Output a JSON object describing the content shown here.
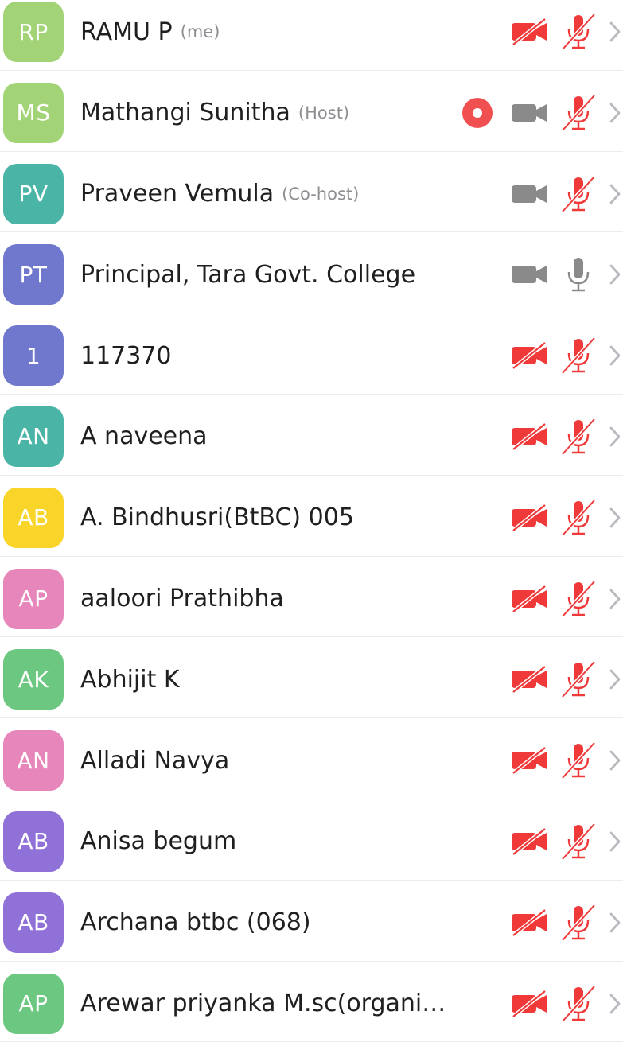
{
  "colors": {
    "muted_red": "#f03a3a",
    "active_gray": "#8a8a8a",
    "recording_red": "#f05050",
    "chevron": "#b9b9bf"
  },
  "icons": {
    "video": "video-camera-icon",
    "video_off": "video-off-icon",
    "mic": "microphone-icon",
    "mic_off": "microphone-muted-icon",
    "recording": "recording-icon",
    "chevron": "chevron-right-icon"
  },
  "participants": [
    {
      "initials": "RP",
      "name": "RAMU P",
      "tag": "(me)",
      "color": "#a2d477",
      "video": "off",
      "audio": "muted",
      "recording": false
    },
    {
      "initials": "MS",
      "name": "Mathangi Sunitha",
      "tag": "(Host)",
      "color": "#a2d477",
      "video": "on",
      "audio": "muted",
      "recording": true
    },
    {
      "initials": "PV",
      "name": "Praveen Vemula",
      "tag": "(Co-host)",
      "color": "#4ab5a6",
      "video": "on",
      "audio": "muted",
      "recording": false
    },
    {
      "initials": "PT",
      "name": "Principal, Tara Govt. College",
      "tag": "",
      "color": "#6f78cc",
      "video": "on",
      "audio": "on",
      "recording": false
    },
    {
      "initials": "1",
      "name": "117370",
      "tag": "",
      "color": "#6f78cc",
      "video": "off",
      "audio": "muted",
      "recording": false
    },
    {
      "initials": "AN",
      "name": "A naveena",
      "tag": "",
      "color": "#4ab5a6",
      "video": "off",
      "audio": "muted",
      "recording": false
    },
    {
      "initials": "AB",
      "name": "A. Bindhusri(BtBC) 005",
      "tag": "",
      "color": "#f9d429",
      "video": "off",
      "audio": "muted",
      "recording": false
    },
    {
      "initials": "AP",
      "name": "aaloori Prathibha",
      "tag": "",
      "color": "#e786bb",
      "video": "off",
      "audio": "muted",
      "recording": false
    },
    {
      "initials": "AK",
      "name": "Abhijit K",
      "tag": "",
      "color": "#6cc780",
      "video": "off",
      "audio": "muted",
      "recording": false
    },
    {
      "initials": "AN",
      "name": "Alladi Navya",
      "tag": "",
      "color": "#e786bb",
      "video": "off",
      "audio": "muted",
      "recording": false
    },
    {
      "initials": "AB",
      "name": "Anisa begum",
      "tag": "",
      "color": "#9071d8",
      "video": "off",
      "audio": "muted",
      "recording": false
    },
    {
      "initials": "AB",
      "name": "Archana btbc (068)",
      "tag": "",
      "color": "#9071d8",
      "video": "off",
      "audio": "muted",
      "recording": false
    },
    {
      "initials": "AP",
      "name": "Arewar priyanka M.sc(organic c...",
      "tag": "",
      "color": "#6cc780",
      "video": "off",
      "audio": "muted",
      "recording": false
    }
  ]
}
